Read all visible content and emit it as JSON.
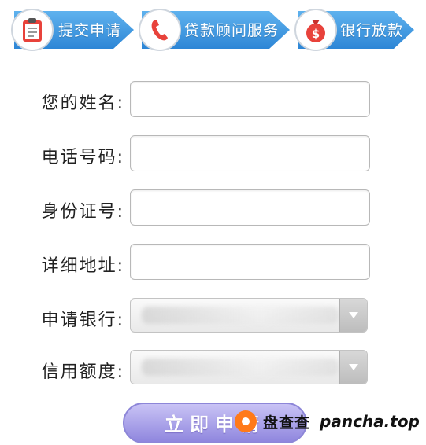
{
  "steps": [
    {
      "label": "提交申请",
      "icon": "clipboard-icon"
    },
    {
      "label": "贷款顾问服务",
      "icon": "phone-icon"
    },
    {
      "label": "银行放款",
      "icon": "money-bag-icon"
    }
  ],
  "form": {
    "name_label": "您的姓名:",
    "phone_label": "电话号码:",
    "id_label": "身份证号:",
    "address_label": "详细地址:",
    "bank_label": "申请银行:",
    "credit_label": "信用额度:"
  },
  "submit_label": "立即申请",
  "watermark": {
    "cn": "盘查查",
    "en": "pancha.top"
  },
  "colors": {
    "step_blue": "#2d86d6",
    "submit_purple": "#9b93e3",
    "watermark_orange": "#ff7a1a"
  }
}
